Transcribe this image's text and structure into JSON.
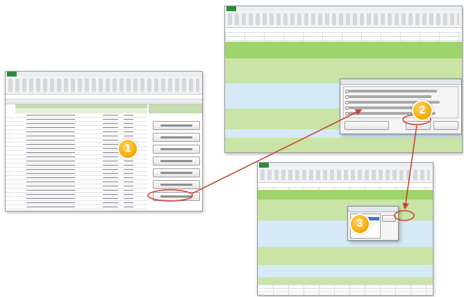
{
  "badges": [
    "1",
    "2",
    "3"
  ],
  "colors": {
    "arrow": "#c8432f",
    "badge": "#f2a900",
    "header_green": "#9fd36b",
    "band_green": "#c9e4a6",
    "band_blue": "#d5e9f6",
    "file_tab": "#2a8a3a"
  },
  "icons": [
    "arrow-connector-icon",
    "callout-circle-icon",
    "radio-icon"
  ]
}
